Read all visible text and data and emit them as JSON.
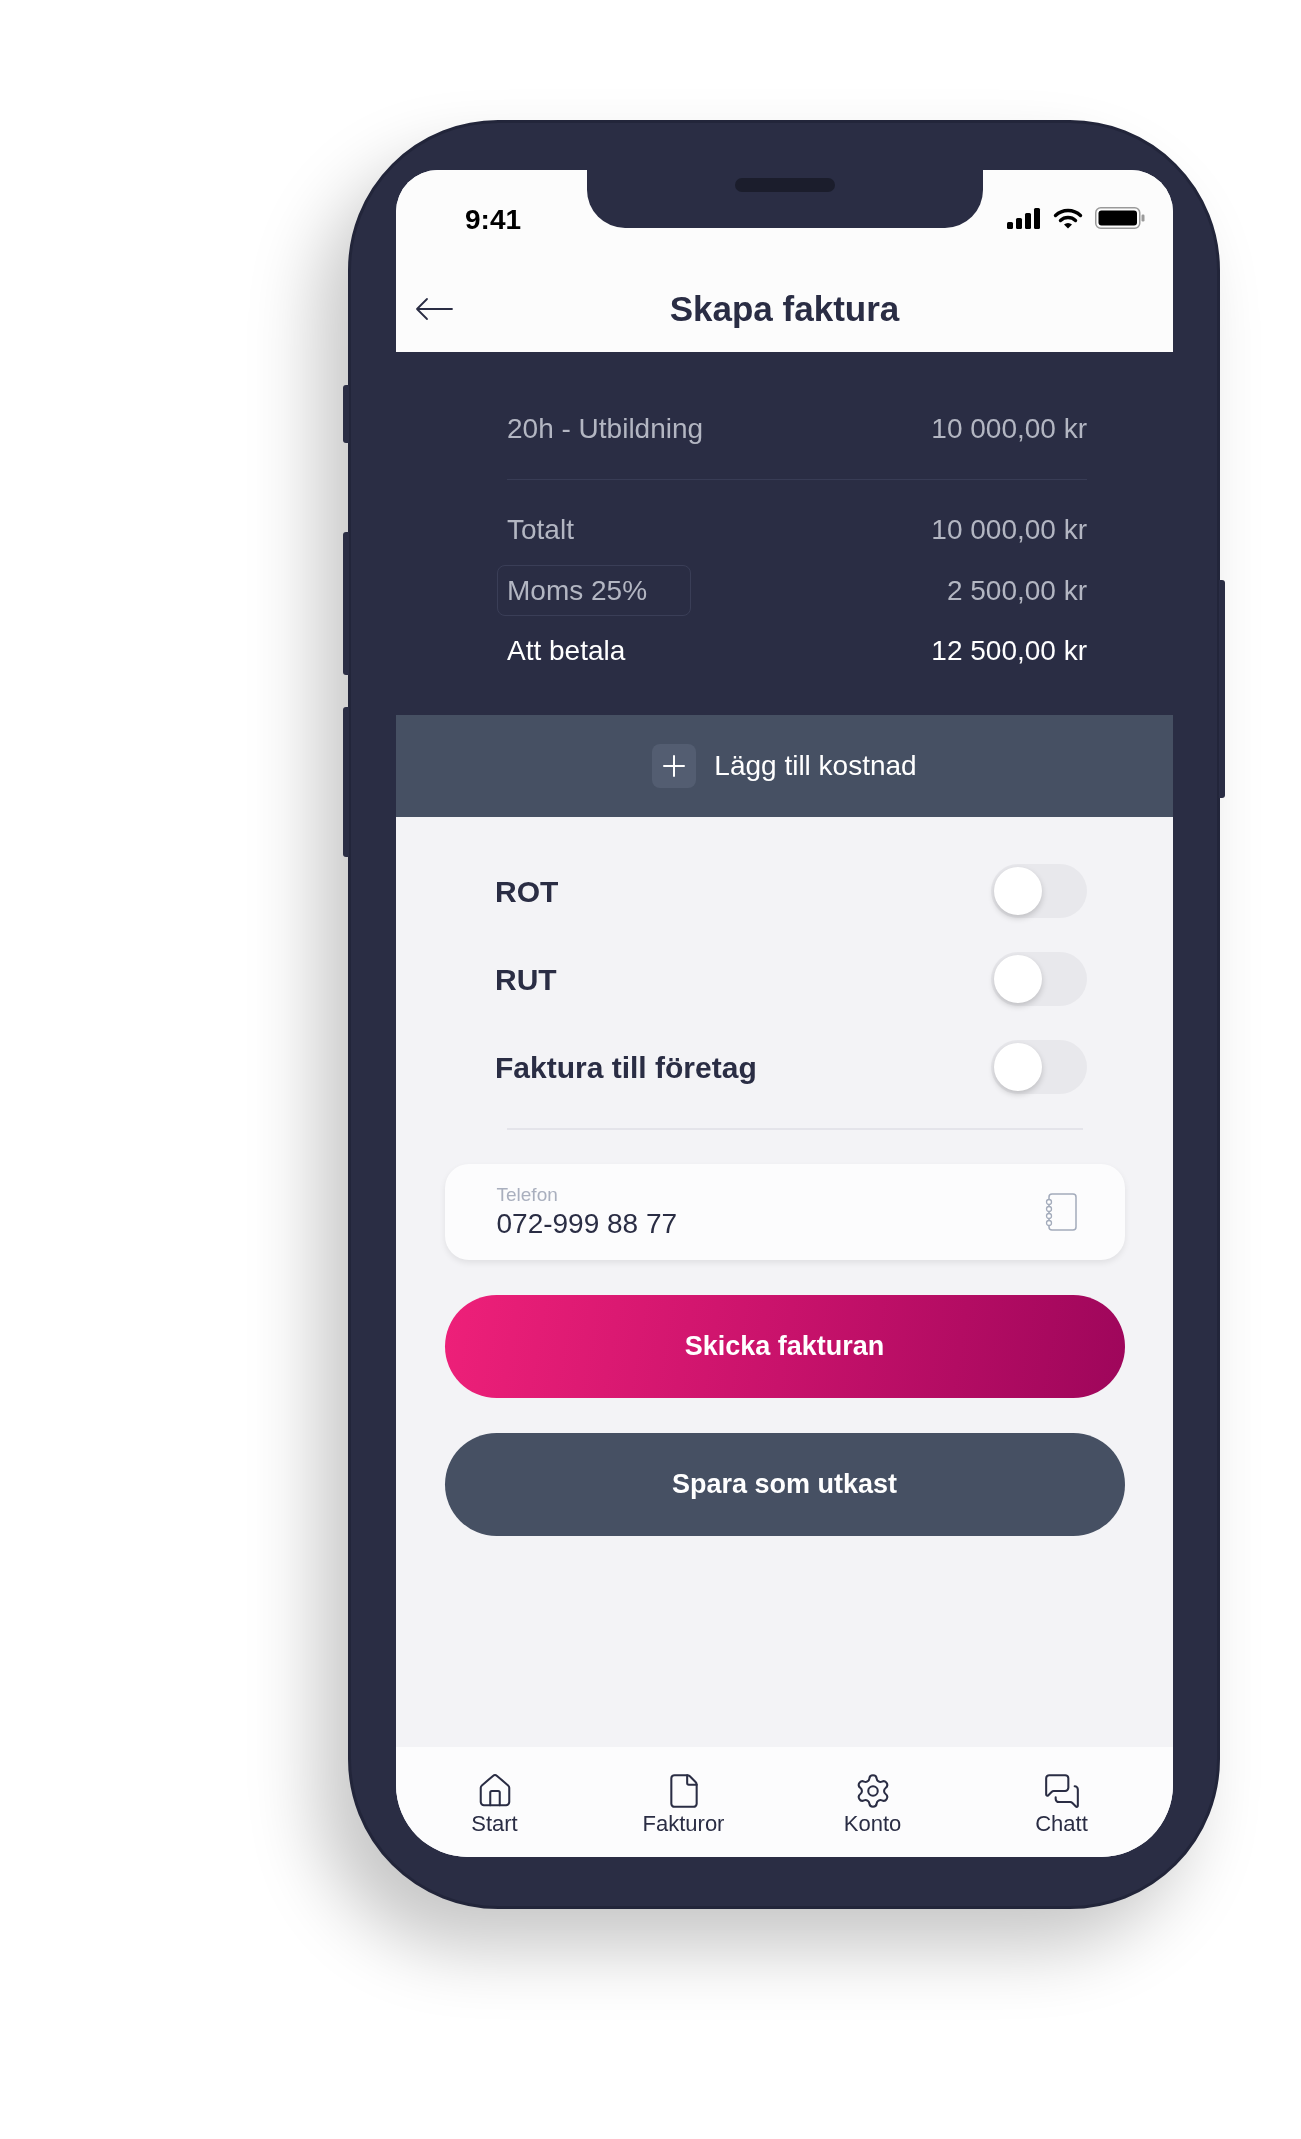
{
  "status_bar": {
    "time": "9:41"
  },
  "header": {
    "title": "Skapa faktura"
  },
  "line_items": [
    {
      "label": "20h - Utbildning",
      "amount": "10 000,00 kr"
    }
  ],
  "summary": [
    {
      "label": "Totalt",
      "amount": "10 000,00 kr",
      "kind": "subtotal"
    },
    {
      "label": "Moms 25%",
      "amount": "2 500,00 kr",
      "kind": "selector"
    },
    {
      "label": "Att betala",
      "amount": "12 500,00 kr",
      "kind": "total"
    }
  ],
  "add_cost_button": {
    "label": "Lägg till kostnad"
  },
  "toggles": [
    {
      "label": "ROT",
      "on": false
    },
    {
      "label": "RUT",
      "on": false
    },
    {
      "label": "Faktura till företag",
      "on": false
    }
  ],
  "phone_field": {
    "label": "Telefon",
    "value": "072-999 88 77"
  },
  "buttons": [
    {
      "label": "Skicka fakturan",
      "kind": "primary"
    },
    {
      "label": "Spara som utkast",
      "kind": "secondary"
    }
  ],
  "bottom_nav": [
    {
      "label": "Start"
    },
    {
      "label": "Fakturor"
    },
    {
      "label": "Konto"
    },
    {
      "label": "Chatt"
    }
  ]
}
